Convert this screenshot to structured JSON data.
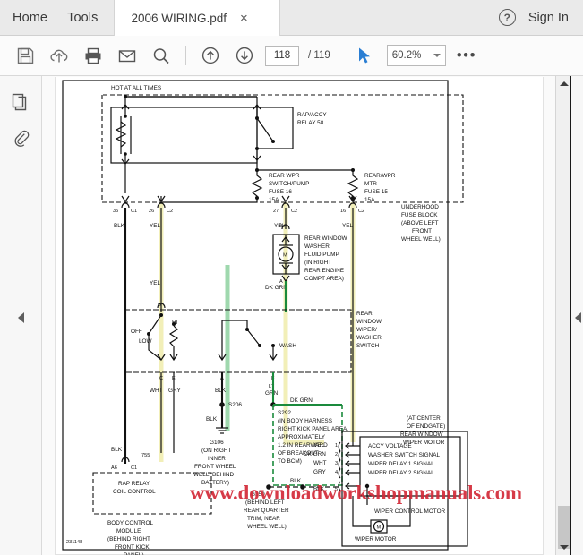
{
  "window": {
    "menu": [
      {
        "label": "Home",
        "name": "home"
      },
      {
        "label": "Tools",
        "name": "tools"
      }
    ],
    "tab": {
      "title": "2006 WIRING.pdf",
      "close": "×"
    },
    "help_icon": "?",
    "sign_in": "Sign In"
  },
  "toolbar": {
    "icons": [
      {
        "name": "save-icon"
      },
      {
        "name": "upload-cloud-icon"
      },
      {
        "name": "print-icon"
      },
      {
        "name": "email-icon"
      },
      {
        "name": "search-icon"
      }
    ],
    "page_up_icon": "up-arrow-circle-icon",
    "page_down_icon": "down-arrow-circle-icon",
    "page_current": "118",
    "page_total": "/ 119",
    "select_tool_icon": "cursor-arrow-icon",
    "zoom_value": "60.2%",
    "more_options": "•••"
  },
  "sidebar": {
    "items": [
      {
        "name": "page-thumbnails-icon"
      },
      {
        "name": "attachments-icon"
      }
    ]
  },
  "scrollbar": {
    "up": "▲",
    "down": "▼"
  },
  "watermark": "www.downloadworkshopmanuals.com",
  "diagram": {
    "id_code": "231148",
    "labels": {
      "hot_at_all_times": "HOT AT ALL TIMES",
      "rap_accy_relay": "RAP/ACCY\nRELAY 58",
      "fuse_switch_pump": "REAR WPR\nSWITCH/PUMP\nFUSE 16\n15A",
      "fuse_motor": "REAR/WPR\nMTR\nFUSE 15\n15A",
      "underhood_fuse_block": "UNDERHOOD\nFUSE BLOCK\n(ABOVE LEFT\nFRONT\nWHEEL WELL)",
      "washer_pump": "REAR WINDOW\nWASHER\nFLUID PUMP\n(IN RIGHT\nREAR ENGINE\nCOMPT AREA)",
      "wiper_washer_switch": "REAR\nWINDOW\nWIPER/\nWASHER\nSWITCH",
      "splice_s292": "S292\n(IN BODY HARNESS\nRIGHT KICK PANEL AREA,\nAPPROXIMATELY\n1.2 IN REARWARD\nOF BREAKOUT\nTO BCM)",
      "ground_g106": "G106\n(ON RIGHT\nINNER\nFRONT WHEEL\nWELL, BEHIND\nBATTERY)",
      "ground_g350": "G350\n(BEHIND LEFT\nREAR QUARTER\nTRIM, NEAR\nWHEEL WELL)",
      "rap_relay_coil": "RAP RELAY\nCOIL CONTROL",
      "bcm": "BODY CONTROL\nMODULE\n(BEHIND RIGHT\nFRONT KICK\nPANEL)",
      "wiper_motor_block": "(AT CENTER\nOF ENDGATE)\nREAR WINDOW\nWIPER MOTOR",
      "wiper_control_motor": "WIPER CONTROL MOTOR",
      "wiper_motor": "WIPER MOTOR",
      "splice_s206": "S206"
    },
    "switch_positions": [
      "OFF",
      "LOW",
      "HI",
      "WASH"
    ],
    "switch_terminals": [
      "B",
      "C",
      "E",
      "A",
      "F"
    ],
    "connector_pins": [
      {
        "num": "35",
        "conn": "C1",
        "color": "BLK"
      },
      {
        "num": "26",
        "conn": "C2",
        "color": "YEL"
      },
      {
        "num": "27",
        "conn": "C2",
        "color": "YEL"
      },
      {
        "num": "16",
        "conn": "C2",
        "color": "YEL"
      }
    ],
    "motor_signals": [
      {
        "color": "YEL",
        "pin": "1",
        "label": "ACCY VOLTAGE"
      },
      {
        "color": "DK GRN",
        "pin": "2",
        "label": "WASHER SWITCH SIGNAL"
      },
      {
        "color": "WHT",
        "pin": "3",
        "label": "WIPER DELAY 1 SIGNAL"
      },
      {
        "color": "GRY",
        "pin": "4",
        "label": "WIPER DELAY 2 SIGNAL"
      },
      {
        "color": "BLK",
        "pin": "5",
        "label": ""
      }
    ],
    "wire_colors": [
      "BLK",
      "YEL",
      "DK GRN",
      "WHT",
      "GRY",
      "LT GRN"
    ],
    "circuit_number": "755",
    "bcm_pin": "A6",
    "bcm_conn": "C1"
  },
  "colors": {
    "accent_blue": "#2a7ed3",
    "watermark_red": "#d32a38",
    "wire_yellow": "#f2f0c0",
    "wire_green": "#1a8a3c",
    "tab_active": "#ffffff",
    "chrome_gray": "#eaeaea"
  }
}
